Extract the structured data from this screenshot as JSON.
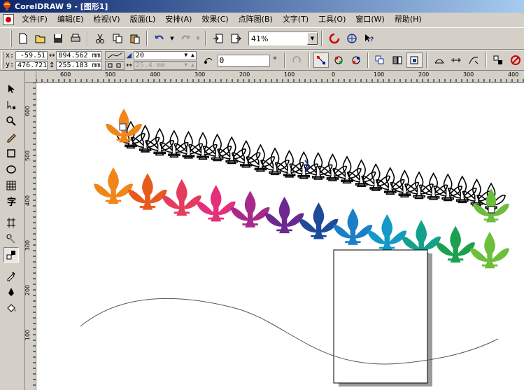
{
  "window": {
    "title": "CorelDRAW 9 - [图形1]"
  },
  "menu": [
    "文件(F)",
    "编辑(E)",
    "检视(V)",
    "版面(L)",
    "安排(A)",
    "效果(C)",
    "点阵图(B)",
    "文字(T)",
    "工具(O)",
    "窗口(W)",
    "帮助(H)"
  ],
  "toolbar": {
    "zoom": "41%"
  },
  "property_bar": {
    "x_label": "x:",
    "y_label": "y:",
    "x_value": "-59.51",
    "y_value": "476.721",
    "width_value": "894.562 mm",
    "height_value": "255.183 mm",
    "steps_value": "20",
    "spacing_value": "25.4 mm",
    "rotation_value": "0",
    "degree_symbol": "°"
  },
  "rulers": {
    "horizontal": [
      "600",
      "500",
      "400",
      "300",
      "200",
      "100",
      "0",
      "100",
      "200",
      "300",
      "400"
    ],
    "vertical": [
      "600",
      "500",
      "400",
      "300",
      "200",
      "100"
    ]
  },
  "blend": {
    "row_colors": [
      "#f0861a",
      "#e85a1c",
      "#e43c5c",
      "#e4307a",
      "#a82a88",
      "#6a2890",
      "#1e4a9a",
      "#1c7ec8",
      "#1498c8",
      "#14a08c",
      "#1ca050",
      "#6cbe3c"
    ]
  },
  "colors": {
    "title_start": "#0a246a",
    "title_end": "#a6caf0",
    "chrome": "#d4d0c8"
  }
}
